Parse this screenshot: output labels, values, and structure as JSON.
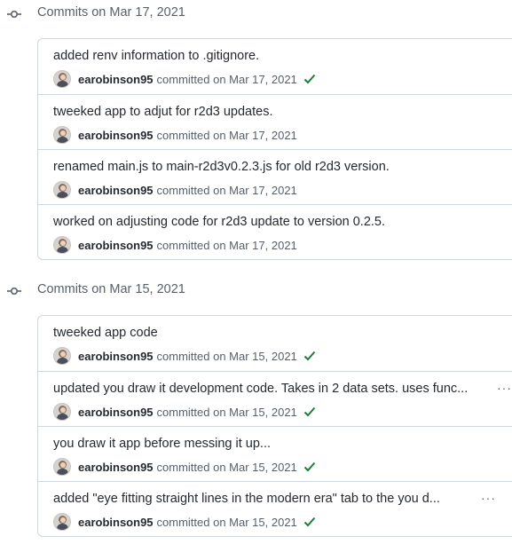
{
  "groups": [
    {
      "title": "Commits on Mar 17, 2021",
      "commits": [
        {
          "message": "added renv information to .gitignore.",
          "author": "earobinson95",
          "committed": "committed on Mar 17, 2021",
          "verified": true,
          "has_more": false
        },
        {
          "message": "tweeked app to adjut for r2d3 updates.",
          "author": "earobinson95",
          "committed": "committed on Mar 17, 2021",
          "verified": false,
          "has_more": false
        },
        {
          "message": "renamed main.js to main-r2d3v0.2.3.js for old r2d3 version.",
          "author": "earobinson95",
          "committed": "committed on Mar 17, 2021",
          "verified": false,
          "has_more": false
        },
        {
          "message": "worked on adjusting code for r2d3 update to version 0.2.5.",
          "author": "earobinson95",
          "committed": "committed on Mar 17, 2021",
          "verified": false,
          "has_more": false
        }
      ]
    },
    {
      "title": "Commits on Mar 15, 2021",
      "commits": [
        {
          "message": "tweeked app code",
          "author": "earobinson95",
          "committed": "committed on Mar 15, 2021",
          "verified": true,
          "has_more": false
        },
        {
          "message": "updated you draw it development code. Takes in 2 data sets. uses func...",
          "author": "earobinson95",
          "committed": "committed on Mar 15, 2021",
          "verified": true,
          "has_more": true
        },
        {
          "message": "you draw it app before messing it up...",
          "author": "earobinson95",
          "committed": "committed on Mar 15, 2021",
          "verified": true,
          "has_more": false
        },
        {
          "message": "added \"eye fitting straight lines in the modern era\" tab to the you d...",
          "author": "earobinson95",
          "committed": "committed on Mar 15, 2021",
          "verified": true,
          "has_more": true
        }
      ]
    }
  ],
  "ellipsis_label": "···",
  "colors": {
    "check": "#1a7f37",
    "border": "#d0d7de",
    "muted": "#57606a"
  },
  "icons": {
    "group": "git-commit-icon",
    "verified": "check-icon",
    "more": "ellipsis-icon"
  }
}
